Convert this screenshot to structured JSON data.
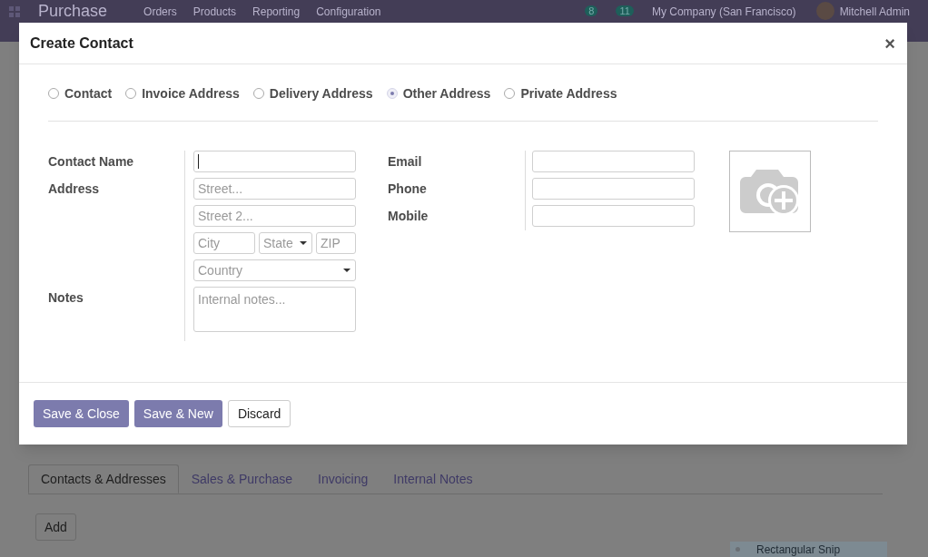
{
  "navbar": {
    "app_name": "Purchase",
    "menu": [
      "Orders",
      "Products",
      "Reporting",
      "Configuration"
    ],
    "activity_count": "8",
    "message_count": "11",
    "company": "My Company (San Francisco)",
    "user": "Mitchell Admin"
  },
  "page": {
    "tabs": [
      {
        "label": "Contacts & Addresses",
        "selected": true
      },
      {
        "label": "Sales & Purchase",
        "selected": false
      },
      {
        "label": "Invoicing",
        "selected": false
      },
      {
        "label": "Internal Notes",
        "selected": false
      }
    ],
    "add_button": "Add",
    "snip_tooltip": "Rectangular Snip"
  },
  "dialog": {
    "title": "Create Contact",
    "close": "×",
    "address_types": [
      {
        "label": "Contact",
        "selected": false
      },
      {
        "label": "Invoice Address",
        "selected": false
      },
      {
        "label": "Delivery Address",
        "selected": false
      },
      {
        "label": "Other Address",
        "selected": true
      },
      {
        "label": "Private Address",
        "selected": false
      }
    ],
    "left_fields": [
      {
        "label": "Contact Name",
        "kind": "text",
        "focused": true
      },
      {
        "label": "Address",
        "kind": "address",
        "street": "Street...",
        "street2": "Street 2...",
        "city": "City",
        "state": "State",
        "zip": "ZIP",
        "country": "Country"
      },
      {
        "label": "Notes",
        "kind": "textarea",
        "placeholder": "Internal notes..."
      }
    ],
    "right_fields": [
      {
        "label": "Email"
      },
      {
        "label": "Phone"
      },
      {
        "label": "Mobile"
      }
    ],
    "buttons": [
      {
        "label": "Save & Close",
        "kind": "primary"
      },
      {
        "label": "Save & New",
        "kind": "primary"
      },
      {
        "label": "Discard",
        "kind": "secondary"
      }
    ]
  }
}
